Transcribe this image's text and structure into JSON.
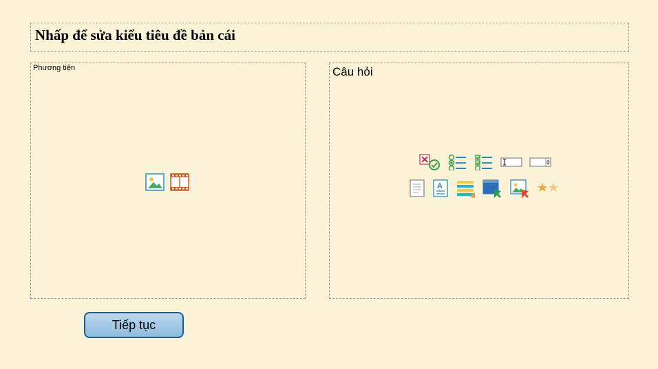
{
  "title": "Nhấp để sửa kiểu tiêu đề bản cái",
  "panels": {
    "media": {
      "label": "Phương tiện"
    },
    "question": {
      "label": "Câu hỏi"
    }
  },
  "button": {
    "label": "Tiếp tục"
  },
  "icons": {
    "media": [
      "picture-icon",
      "film-icon"
    ],
    "question_row1": [
      "true-false-icon",
      "radio-list-icon",
      "check-list-icon",
      "text-field-icon",
      "numeric-field-icon"
    ],
    "question_row2": [
      "document-icon",
      "text-document-icon",
      "highlight-lines-icon",
      "image-click-icon",
      "image-select-icon",
      "stars-icon"
    ]
  }
}
